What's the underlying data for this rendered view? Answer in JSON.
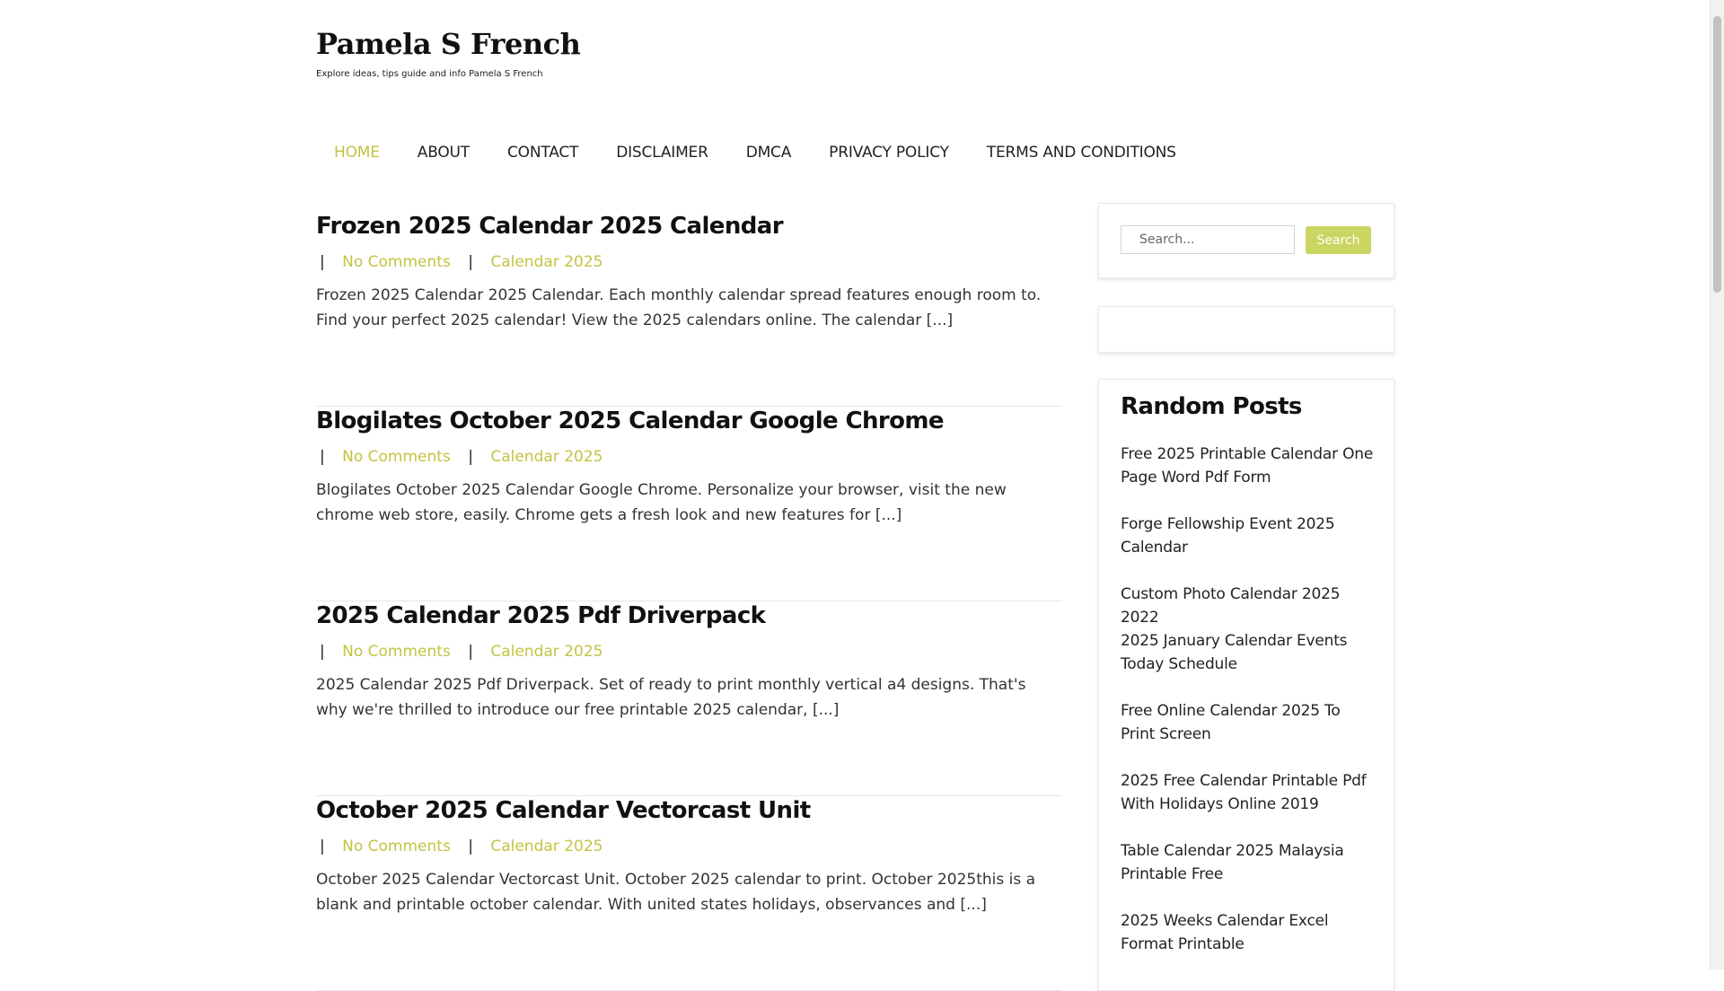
{
  "site": {
    "title": "Pamela S French",
    "description": "Explore ideas, tips guide and info Pamela S French"
  },
  "nav": [
    "HOME",
    "ABOUT",
    "CONTACT",
    "DISCLAIMER",
    "DMCA",
    "PRIVACY POLICY",
    "TERMS AND CONDITIONS"
  ],
  "posts": [
    {
      "title": "Frozen 2025 Calendar 2025 Calendar",
      "comments": "No Comments",
      "category": "Calendar 2025",
      "excerpt": "Frozen 2025 Calendar 2025 Calendar. Each monthly calendar spread features enough room to. Find your perfect 2025 calendar! View the 2025 calendars online. The calendar [...]"
    },
    {
      "title": "Blogilates October 2025 Calendar Google Chrome",
      "comments": "No Comments",
      "category": "Calendar 2025",
      "excerpt": "Blogilates October 2025 Calendar Google Chrome. Personalize your browser, visit the new chrome web store, easily. Chrome gets a fresh look and new features for [...]"
    },
    {
      "title": "2025 Calendar 2025 Pdf Driverpack",
      "comments": "No Comments",
      "category": "Calendar 2025",
      "excerpt": "2025 Calendar 2025 Pdf Driverpack. Set of ready to print monthly vertical a4 designs. That's why we're thrilled to introduce our free printable 2025 calendar, [...]"
    },
    {
      "title": "October 2025 Calendar Vectorcast Unit",
      "comments": "No Comments",
      "category": "Calendar 2025",
      "excerpt": "October 2025 Calendar Vectorcast Unit. October 2025 calendar to print. October 2025this is a blank and printable october calendar. With united states holidays, observances and [...]"
    }
  ],
  "meta_separator": "|",
  "search": {
    "placeholder": "Search...",
    "button": "Search"
  },
  "random_posts": {
    "title": "Random Posts",
    "items": [
      "Free 2025 Printable Calendar One Page Word Pdf Form",
      "Forge Fellowship Event 2025 Calendar",
      "Custom Photo Calendar 2025 2022",
      "2025 January Calendar Events Today Schedule",
      "Free Online Calendar 2025 To Print Screen",
      "2025 Free Calendar Printable Pdf With Holidays Online 2019",
      "Table Calendar 2025 Malaysia Printable Free",
      "2025 Weeks Calendar Excel Format Printable"
    ]
  },
  "colors": {
    "accent": "#c2c441",
    "button": "#cbd561"
  }
}
